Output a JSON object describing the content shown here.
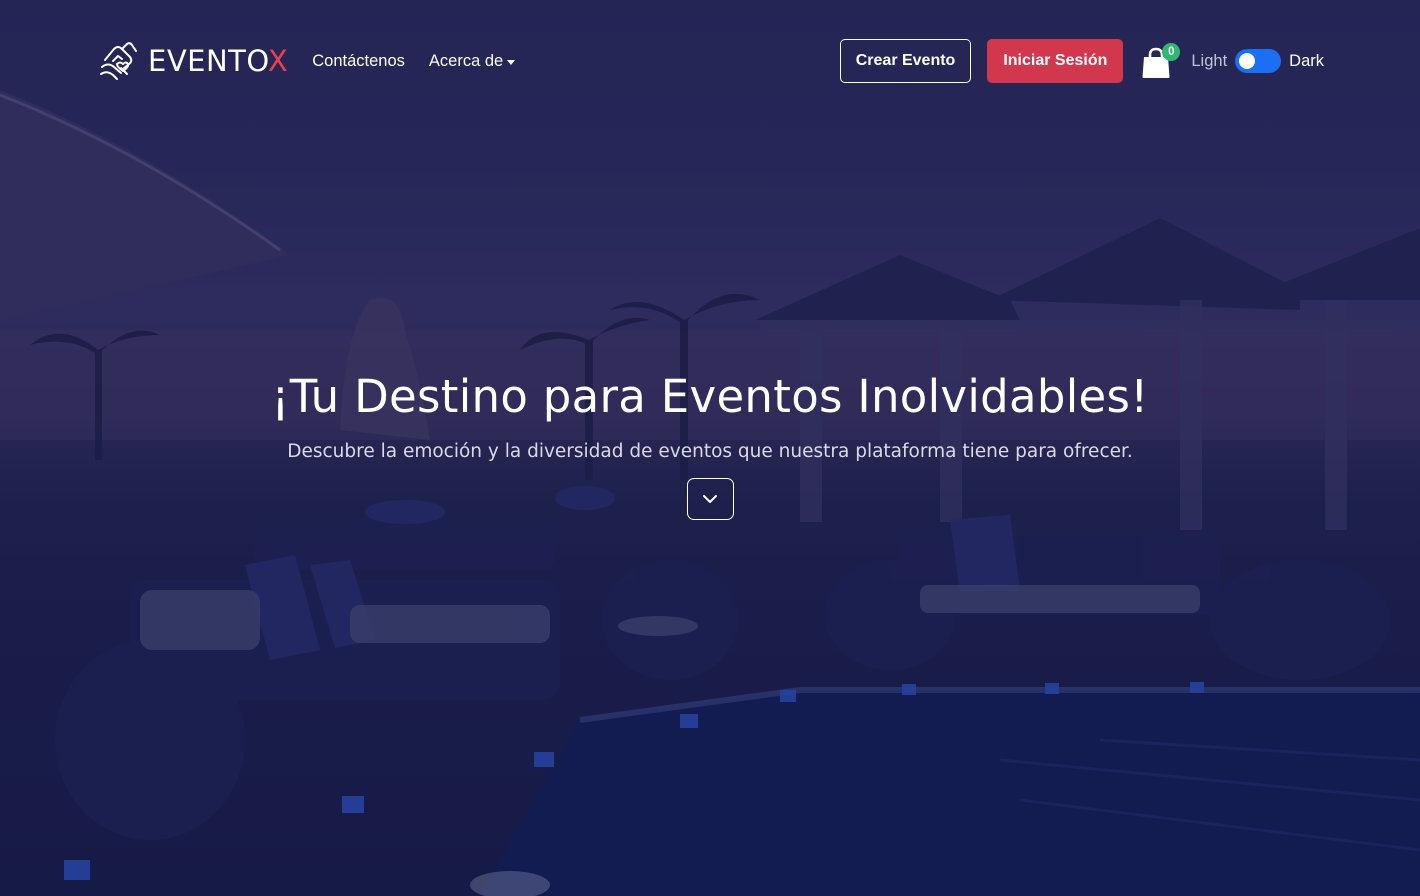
{
  "brand": {
    "name_main": "EVENTO",
    "name_accent": "X",
    "logo_icon": "hand-heart-icon"
  },
  "nav": {
    "links": [
      {
        "label": "Contáctenos"
      },
      {
        "label": "Acerca de",
        "has_dropdown": true
      }
    ],
    "create_event_label": "Crear Evento",
    "login_label": "Iniciar Sesión",
    "cart_icon": "shopping-bag-icon",
    "cart_count": "0",
    "theme_toggle": {
      "light_label": "Light",
      "dark_label": "Dark"
    }
  },
  "hero": {
    "title": "¡Tu Destino para Eventos Inolvidables!",
    "subtitle": "Descubre la emoción y la diversidad de eventos que nuestra plataforma tiene para ofrecer.",
    "scroll_icon": "chevron-down-icon",
    "background": "night-rooftop-pool-lounge-photo"
  },
  "colors": {
    "accent_red": "#d1384d",
    "brand_x": "#e8414f",
    "badge_green": "#2fb872",
    "toggle_blue": "#1b6ff5",
    "overlay": "#1a1c50"
  }
}
